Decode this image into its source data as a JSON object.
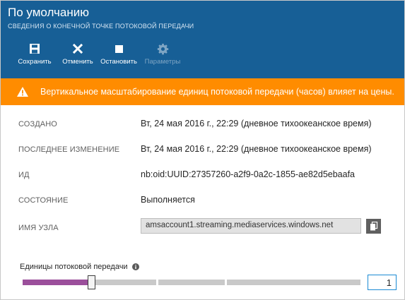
{
  "header": {
    "title": "По умолчанию",
    "subtitle": "СВЕДЕНИЯ О КОНЕЧНОЙ ТОЧКЕ ПОТОКОВОЙ ПЕРЕДАЧИ"
  },
  "toolbar": {
    "save_label": "Сохранить",
    "cancel_label": "Отменить",
    "stop_label": "Остановить",
    "params_label": "Параметры"
  },
  "warning": {
    "text": "Вертикальное масштабирование единиц потоковой передачи (часов) влияет на цены."
  },
  "properties": {
    "created": {
      "label": "СОЗДАНО",
      "value": "Вт, 24 мая 2016 г., 22:29 (дневное тихоокеанское время)"
    },
    "modified": {
      "label": "ПОСЛЕДНЕЕ ИЗМЕНЕНИЕ",
      "value": "Вт, 24 мая 2016 г., 22:29 (дневное тихоокеанское время)"
    },
    "id": {
      "label": "ИД",
      "value": "nb:oid:UUID:27357260-a2f9-0a2c-1855-ae82d5ebaafa"
    },
    "state": {
      "label": "СОСТОЯНИЕ",
      "value": "Выполняется"
    },
    "host": {
      "label": "ИМЯ УЗЛА",
      "value": "amsaccount1.streaming.mediaservices.windows.net"
    }
  },
  "streaming_units": {
    "label": "Единицы потоковой передачи",
    "value": "1",
    "fill_fraction": 0.2
  },
  "colors": {
    "header_bg": "#175f96",
    "warning_bg": "#ff8c00",
    "slider_fill": "#9b4f9b",
    "slider_track": "#c9c9c9",
    "input_border": "#1a8ad4"
  }
}
